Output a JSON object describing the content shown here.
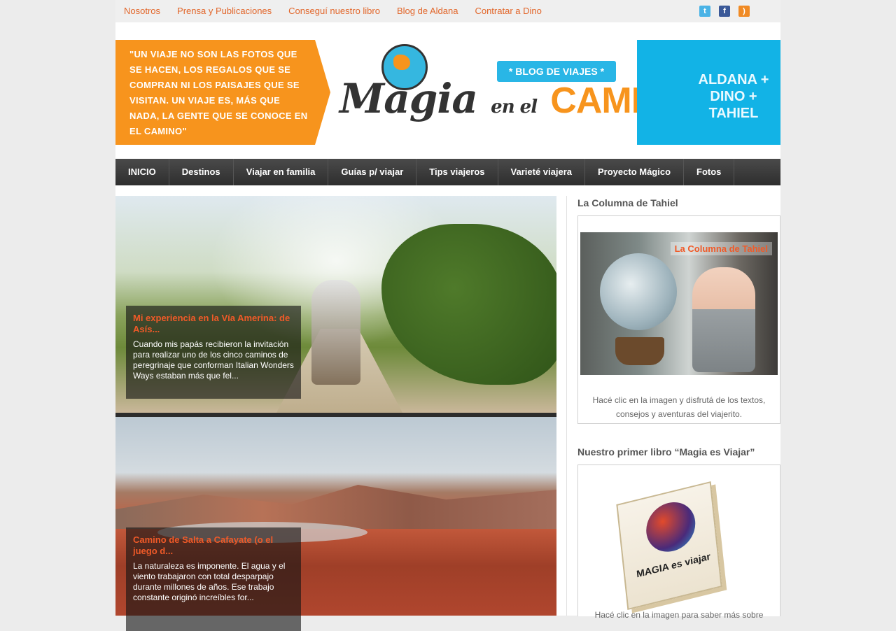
{
  "topbar": {
    "links": [
      "Nosotros",
      "Prensa y Publicaciones",
      "Conseguí nuestro libro",
      "Blog de Aldana",
      "Contratar a Dino"
    ],
    "social_icons": [
      "twitter-icon",
      "facebook-icon",
      "rss-icon"
    ]
  },
  "banner": {
    "quote": "\"UN VIAJE NO SON LAS FOTOS QUE SE HACEN, LOS REGALOS QUE SE COMPRAN NI LOS PAISAJES QUE SE VISITAN. UN VIAJE ES, MÁS QUE NADA, LA GENTE QUE SE CONOCE EN EL CAMINO\"",
    "logo_magia": "Magia",
    "logo_enel": "en el",
    "logo_camino": "CAMINO",
    "tag": "* BLOG DE VIAJES *",
    "right_text": "ALDANA + DINO + TAHIEL"
  },
  "nav": {
    "items": [
      "INICIO",
      "Destinos",
      "Viajar en familia",
      "Guías p/ viajar",
      "Tips viajeros",
      "Varieté viajera",
      "Proyecto Mágico",
      "Fotos"
    ]
  },
  "posts": [
    {
      "title": "Mi experiencia en la Vía Amerina: de Asís...",
      "excerpt": "Cuando mis papás recibieron la invitación para realizar uno de los cinco caminos de peregrinaje que conforman Italian Wonders Ways estaban más que fel..."
    },
    {
      "title": "Camino de Salta a Cafayate (o el juego d...",
      "excerpt": "La naturaleza es imponente. El agua y el viento trabajaron con total desparpajo durante millones de años. Ese trabajo constante originó increíbles for..."
    }
  ],
  "sidebar": {
    "widget1": {
      "title": "La Columna de Tahiel",
      "image_label": "La Columna de Tahiel",
      "text": "Hacé clic en la imagen y disfrutá de los textos, consejos y aventuras del viajerito."
    },
    "widget2": {
      "title": "Nuestro primer libro “Magia es Viajar”",
      "book_title": "MAGIA es viajar",
      "text": "Hacé clic en la imagen para saber más sobre"
    }
  },
  "colors": {
    "accent": "#e2662a",
    "nav_bg": "#3a3a3a",
    "banner_orange": "#f7941d",
    "banner_blue": "#12b3e6"
  }
}
